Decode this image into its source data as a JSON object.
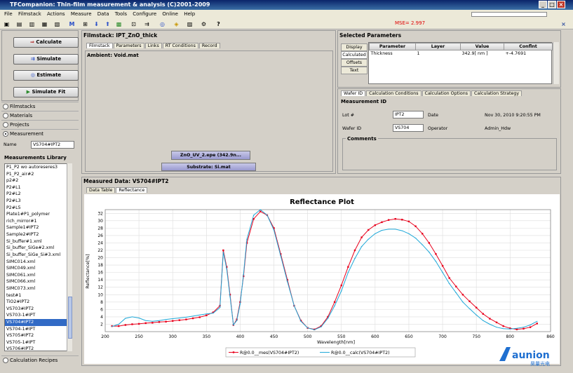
{
  "window": {
    "title": "TFCompanion: Thin-film measurement & analysis (C)2001-2009"
  },
  "menu": [
    "File",
    "Filmstack",
    "Actions",
    "Measure",
    "Data",
    "Tools",
    "Configure",
    "Online",
    "Help"
  ],
  "status": {
    "mse": "MSE= 2.997"
  },
  "actions": {
    "calculate": "Calculate",
    "simulate": "Simulate",
    "estimate": "Estimate",
    "simulate_fit": "Simulate Fit"
  },
  "nav": {
    "filmstacks": "Filmstacks",
    "materials": "Materials",
    "projects": "Projects",
    "measurement": "Measurement",
    "recipes": "Calculation Recipes"
  },
  "name_field": {
    "label": "Name",
    "value": "VS704#IPT2"
  },
  "library": {
    "title": "Measurements Library",
    "items": [
      "P1_P2 wo autoreseres3",
      "P1_P2_air#2",
      "p2#2",
      "P2#L1",
      "P2#L2",
      "P2#L3",
      "P2#L5",
      "Plate1#P1_polymer",
      "rich_mirror#1",
      "Sample1#IPT2",
      "Sample2#IPT2",
      "Si_buffer#1.xml",
      "Si_buffer_SiGe#2.xml",
      "Si_buffer_SiGe_Si#3.xml",
      "SIMC014.xml",
      "SIMC049.xml",
      "SIMC061.xml",
      "SIMC066.xml",
      "SIMC073.xml",
      "test#1",
      "TiO2#IPT2",
      "VS703#IPT2",
      "VS703-1#IPT",
      "VS704#IPT2",
      "VS704-1#IPT",
      "VS705#IPT2",
      "VS705-1#IPT",
      "VS706#IPT2"
    ],
    "selected": "VS704#IPT2"
  },
  "filmstack": {
    "title": "Filmstack: IPT_ZnO_thick",
    "tabs": [
      "Filmstack",
      "Parameters",
      "Links",
      "RT Conditions",
      "Record"
    ],
    "ambient": "Ambient: Void.mat",
    "layer": "ZnO_UV_2.epe (342.9n...",
    "substrate": "Substrate: Si.mat"
  },
  "selected_params": {
    "title": "Selected Parameters",
    "side_tabs": [
      "Display",
      "Calculated",
      "Offsets",
      "Text"
    ],
    "columns": [
      "Parameter",
      "Layer",
      "Value",
      "Conflnt"
    ],
    "rows": [
      {
        "parameter": "Thickness",
        "layer": "1",
        "value": "342.9[ nm ]",
        "conf": "+-4.7691"
      }
    ]
  },
  "wafer": {
    "tabs": [
      "Wafer ID",
      "Calculation Conditions",
      "Calculation Options",
      "Calculation Strategy"
    ],
    "section": "Measurement ID",
    "lot_label": "Lot #",
    "lot": "IPT2",
    "date_label": "Date",
    "date": "Nov 30, 2010 9:20:55 PM",
    "wafer_label": "Wafer ID",
    "wafer_id": "VS704",
    "operator_label": "Operator",
    "operator": "Admin_Hdw",
    "comments_label": "Comments"
  },
  "measured": {
    "title": "Measured Data: VS704#IPT2",
    "tabs": [
      "Data Table",
      "Reflectance"
    ]
  },
  "colors": {
    "measured": "#e8001c",
    "calculated": "#1fa8d8"
  },
  "chart_data": {
    "type": "line",
    "title": "Reflectance Plot",
    "xlabel": "Wavelength[nm]",
    "ylabel": "Reflectance[%]",
    "xlim": [
      200,
      860
    ],
    "ylim": [
      0,
      33
    ],
    "xticks": [
      200,
      250,
      300,
      350,
      400,
      450,
      500,
      550,
      600,
      650,
      700,
      750,
      800,
      860
    ],
    "yticks": [
      2,
      4,
      6,
      8,
      10,
      12,
      14,
      16,
      18,
      20,
      22,
      24,
      26,
      28,
      30,
      32
    ],
    "grid": true,
    "legend_position": "bottom-center",
    "series": [
      {
        "name": "R@0.0__mes(VS704#IPT2)",
        "x": [
          210,
          220,
          230,
          240,
          250,
          260,
          270,
          280,
          290,
          300,
          310,
          320,
          330,
          340,
          350,
          360,
          370,
          375,
          380,
          385,
          390,
          395,
          400,
          405,
          410,
          420,
          430,
          440,
          450,
          460,
          470,
          480,
          490,
          500,
          510,
          520,
          530,
          540,
          550,
          560,
          570,
          580,
          590,
          600,
          610,
          620,
          630,
          640,
          650,
          660,
          670,
          680,
          690,
          700,
          710,
          720,
          730,
          740,
          750,
          760,
          770,
          780,
          790,
          800,
          810,
          820,
          830,
          840
        ],
        "values": [
          1.5,
          1.5,
          1.8,
          2.0,
          2.1,
          2.3,
          2.4,
          2.6,
          2.7,
          2.9,
          3.1,
          3.3,
          3.6,
          3.9,
          4.4,
          5.2,
          7.0,
          22.0,
          17.5,
          10.0,
          1.8,
          3.3,
          8.0,
          15.0,
          24.0,
          30.5,
          32.5,
          31.5,
          28.0,
          21.0,
          14.0,
          7.0,
          3.0,
          1.0,
          0.6,
          1.5,
          4.0,
          8.0,
          12.5,
          17.5,
          22.0,
          25.5,
          27.5,
          28.8,
          29.6,
          30.2,
          30.5,
          30.3,
          29.8,
          28.5,
          26.5,
          24.0,
          21.0,
          17.8,
          14.5,
          12.2,
          10.0,
          8.2,
          6.5,
          4.8,
          3.5,
          2.5,
          1.5,
          0.9,
          0.6,
          0.8,
          1.2,
          2.2
        ]
      },
      {
        "name": "R@0.0__calc(VS704#IPT2)",
        "x": [
          210,
          220,
          230,
          240,
          250,
          260,
          270,
          280,
          290,
          300,
          310,
          320,
          330,
          340,
          350,
          360,
          370,
          375,
          380,
          385,
          390,
          395,
          400,
          405,
          410,
          420,
          430,
          440,
          450,
          460,
          470,
          480,
          490,
          500,
          510,
          520,
          530,
          540,
          550,
          560,
          570,
          580,
          590,
          600,
          610,
          620,
          630,
          640,
          650,
          660,
          670,
          680,
          690,
          700,
          710,
          720,
          730,
          740,
          750,
          760,
          770,
          780,
          790,
          800,
          810,
          820,
          830,
          840
        ],
        "values": [
          1.4,
          2.0,
          3.6,
          4.0,
          3.7,
          3.0,
          2.8,
          3.0,
          3.3,
          3.5,
          3.7,
          3.9,
          4.2,
          4.5,
          4.8,
          5.0,
          6.5,
          21.5,
          17.0,
          9.5,
          1.8,
          3.0,
          7.5,
          15.5,
          25.0,
          31.5,
          33.0,
          31.5,
          27.5,
          20.5,
          13.5,
          7.0,
          2.8,
          1.0,
          0.5,
          1.3,
          3.6,
          7.0,
          11.0,
          16.0,
          19.8,
          23.0,
          25.0,
          26.5,
          27.4,
          27.7,
          27.7,
          27.3,
          26.5,
          25.3,
          23.5,
          21.5,
          19.0,
          16.0,
          13.0,
          10.5,
          8.0,
          6.2,
          4.5,
          3.0,
          2.0,
          1.2,
          0.8,
          0.7,
          0.9,
          1.2,
          1.8,
          2.8
        ]
      }
    ]
  },
  "logo": {
    "text": "aunion",
    "sub": "昊量光电"
  }
}
